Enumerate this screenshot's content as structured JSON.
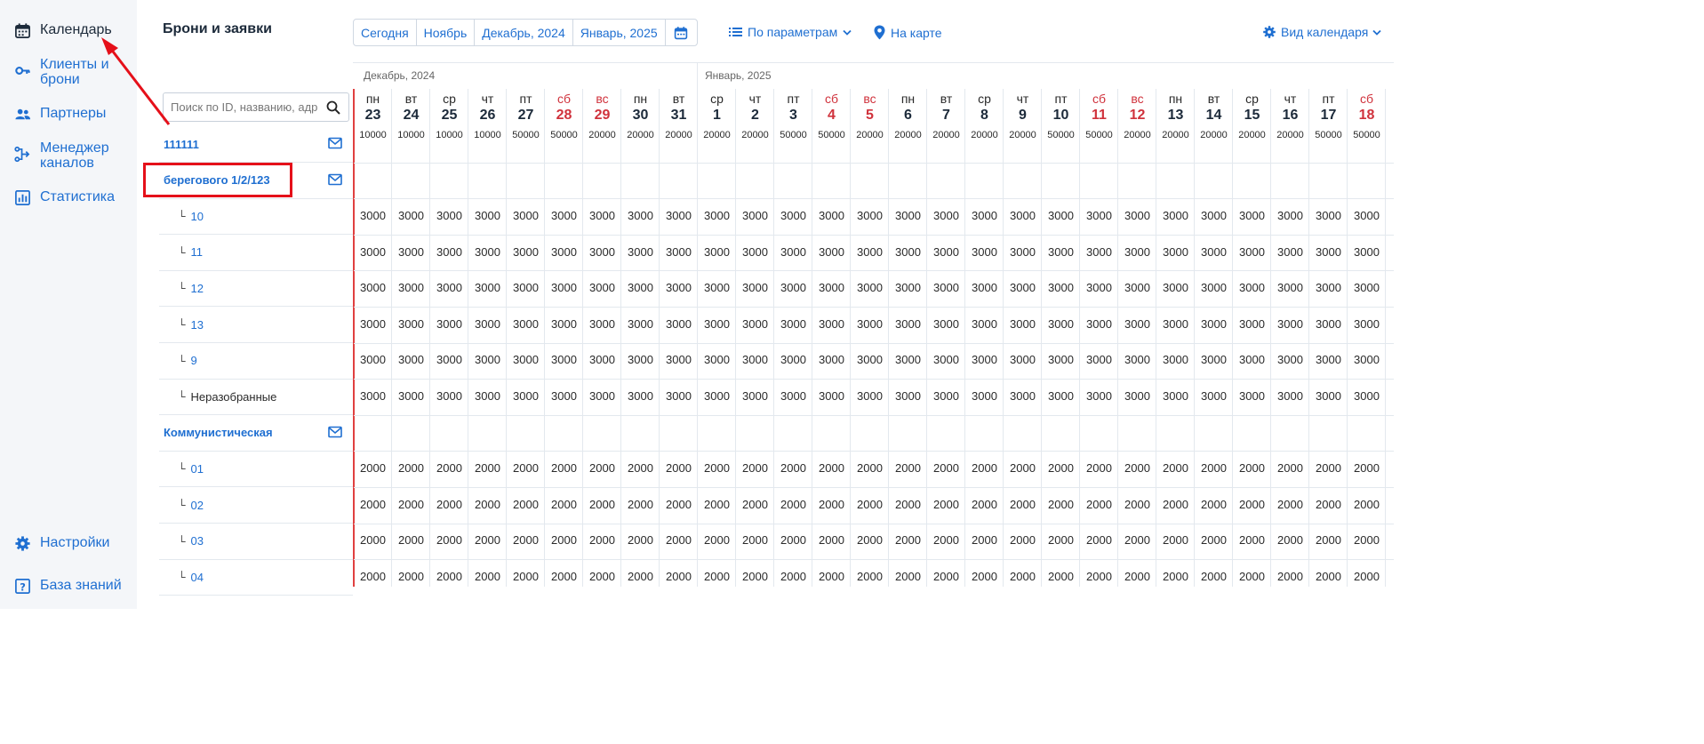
{
  "sidebar": {
    "items": [
      {
        "label": "Календарь",
        "icon": "calendar-icon",
        "active": true
      },
      {
        "label": "Клиенты и брони",
        "icon": "key-icon",
        "active": false
      },
      {
        "label": "Партнеры",
        "icon": "users-icon",
        "active": false
      },
      {
        "label": "Менеджер каналов",
        "icon": "channels-icon",
        "active": false
      },
      {
        "label": "Статистика",
        "icon": "chart-icon",
        "active": false
      },
      {
        "label": "Настройки",
        "icon": "gear-icon",
        "active": false
      },
      {
        "label": "База знаний",
        "icon": "help-icon",
        "active": false
      }
    ]
  },
  "header": {
    "title": "Брони и заявки",
    "period_buttons": [
      "Сегодня",
      "Ноябрь",
      "Декабрь, 2024",
      "Январь, 2025"
    ],
    "filters_label": "По параметрам",
    "map_label": "На карте",
    "view_label": "Вид календаря"
  },
  "search": {
    "placeholder": "Поиск по ID, названию, адресу"
  },
  "months": [
    {
      "label": "Декабрь, 2024"
    },
    {
      "label": "Январь, 2025"
    }
  ],
  "days": [
    {
      "dow": "пн",
      "num": "23",
      "weekend": false,
      "total": "10000"
    },
    {
      "dow": "вт",
      "num": "24",
      "weekend": false,
      "total": "10000"
    },
    {
      "dow": "ср",
      "num": "25",
      "weekend": false,
      "total": "10000"
    },
    {
      "dow": "чт",
      "num": "26",
      "weekend": false,
      "total": "10000"
    },
    {
      "dow": "пт",
      "num": "27",
      "weekend": false,
      "total": "50000"
    },
    {
      "dow": "сб",
      "num": "28",
      "weekend": true,
      "total": "50000"
    },
    {
      "dow": "вс",
      "num": "29",
      "weekend": true,
      "total": "20000"
    },
    {
      "dow": "пн",
      "num": "30",
      "weekend": false,
      "total": "20000"
    },
    {
      "dow": "вт",
      "num": "31",
      "weekend": false,
      "total": "20000"
    },
    {
      "dow": "ср",
      "num": "1",
      "weekend": false,
      "total": "20000"
    },
    {
      "dow": "чт",
      "num": "2",
      "weekend": false,
      "total": "20000"
    },
    {
      "dow": "пт",
      "num": "3",
      "weekend": false,
      "total": "50000"
    },
    {
      "dow": "сб",
      "num": "4",
      "weekend": true,
      "total": "50000"
    },
    {
      "dow": "вс",
      "num": "5",
      "weekend": true,
      "total": "20000"
    },
    {
      "dow": "пн",
      "num": "6",
      "weekend": false,
      "total": "20000"
    },
    {
      "dow": "вт",
      "num": "7",
      "weekend": false,
      "total": "20000"
    },
    {
      "dow": "ср",
      "num": "8",
      "weekend": false,
      "total": "20000"
    },
    {
      "dow": "чт",
      "num": "9",
      "weekend": false,
      "total": "20000"
    },
    {
      "dow": "пт",
      "num": "10",
      "weekend": false,
      "total": "50000"
    },
    {
      "dow": "сб",
      "num": "11",
      "weekend": true,
      "total": "50000"
    },
    {
      "dow": "вс",
      "num": "12",
      "weekend": true,
      "total": "20000"
    },
    {
      "dow": "пн",
      "num": "13",
      "weekend": false,
      "total": "20000"
    },
    {
      "dow": "вт",
      "num": "14",
      "weekend": false,
      "total": "20000"
    },
    {
      "dow": "ср",
      "num": "15",
      "weekend": false,
      "total": "20000"
    },
    {
      "dow": "чт",
      "num": "16",
      "weekend": false,
      "total": "20000"
    },
    {
      "dow": "пт",
      "num": "17",
      "weekend": false,
      "total": "50000"
    },
    {
      "dow": "сб",
      "num": "18",
      "weekend": true,
      "total": "50000"
    }
  ],
  "rows": [
    {
      "type": "group",
      "label": "111111",
      "mail": true
    },
    {
      "type": "group",
      "label": "берегового 1/2/123",
      "mail": true,
      "highlighted": true
    },
    {
      "type": "unit",
      "label": "10",
      "price": "3000"
    },
    {
      "type": "unit",
      "label": "11",
      "price": "3000"
    },
    {
      "type": "unit",
      "label": "12",
      "price": "3000"
    },
    {
      "type": "unit",
      "label": "13",
      "price": "3000"
    },
    {
      "type": "unit",
      "label": "9",
      "price": "3000"
    },
    {
      "type": "unit",
      "label": "Неразобранные",
      "price": "3000",
      "dark": true
    },
    {
      "type": "group",
      "label": "Коммунистическая",
      "mail": true
    },
    {
      "type": "unit",
      "label": "01",
      "price": "2000"
    },
    {
      "type": "unit",
      "label": "02",
      "price": "2000"
    },
    {
      "type": "unit",
      "label": "03",
      "price": "2000"
    },
    {
      "type": "unit",
      "label": "04",
      "price": "2000"
    }
  ],
  "colors": {
    "accent": "#1f6fd1",
    "weekend": "#d0323c",
    "annotation": "#e5101a"
  }
}
